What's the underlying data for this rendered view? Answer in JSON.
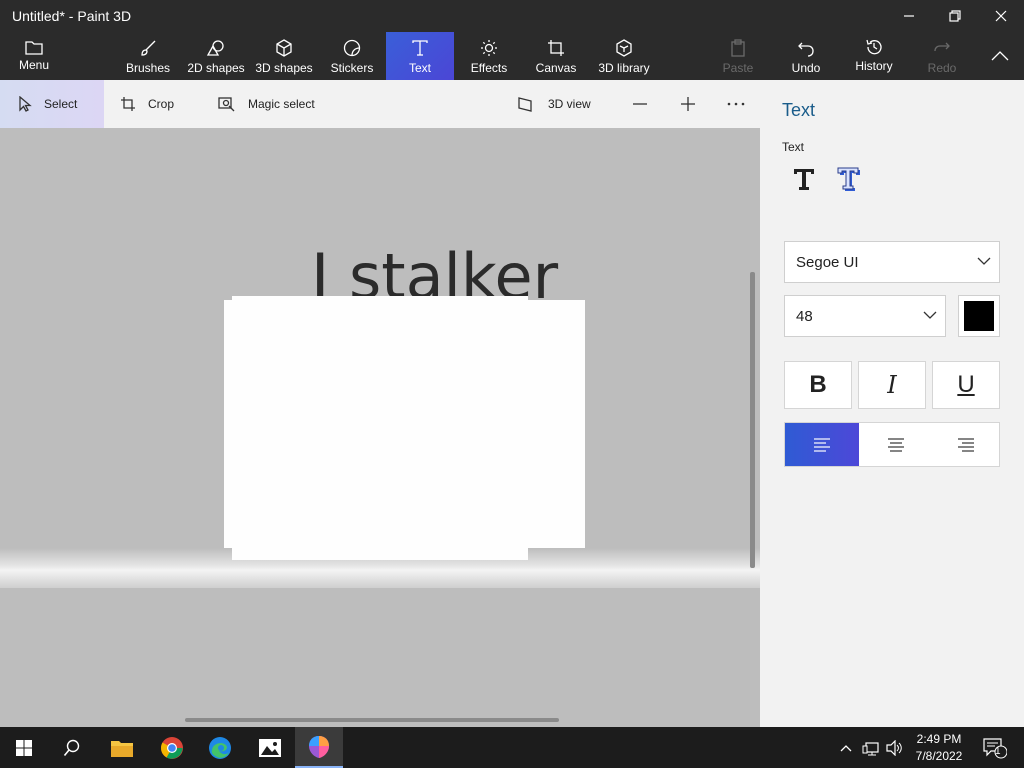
{
  "window": {
    "title": "Untitled* - Paint 3D"
  },
  "ribbon": {
    "items": [
      {
        "label": "Menu",
        "icon": "folder-icon"
      },
      {
        "label": "Brushes",
        "icon": "brush-icon"
      },
      {
        "label": "2D shapes",
        "icon": "2d-shapes-icon"
      },
      {
        "label": "3D shapes",
        "icon": "cube-icon"
      },
      {
        "label": "Stickers",
        "icon": "sticker-icon"
      },
      {
        "label": "Text",
        "icon": "text-icon",
        "active": true
      },
      {
        "label": "Effects",
        "icon": "sun-icon"
      },
      {
        "label": "Canvas",
        "icon": "canvas-icon"
      },
      {
        "label": "3D library",
        "icon": "3d-library-icon"
      },
      {
        "label": "Paste",
        "icon": "clipboard-icon",
        "disabled": true
      },
      {
        "label": "Undo",
        "icon": "undo-icon"
      },
      {
        "label": "History",
        "icon": "history-icon"
      },
      {
        "label": "Redo",
        "icon": "redo-icon",
        "disabled": true
      }
    ]
  },
  "toolbar": {
    "select": "Select",
    "crop": "Crop",
    "magic_select": "Magic select",
    "view_3d": "3D view"
  },
  "canvas": {
    "text": "I stalker"
  },
  "panel": {
    "title": "Text",
    "text_label": "Text",
    "font": "Segoe UI",
    "size": "48",
    "text_color": "#000000",
    "bold": "B",
    "italic": "I",
    "underline": "U",
    "alignment": "left"
  },
  "taskbar": {
    "time": "2:49 PM",
    "date": "7/8/2022",
    "notification_count": "1"
  },
  "colors": {
    "accent": "#3a5fd8",
    "panel_title": "#1a5c8a",
    "workspace": "#bdbdbd"
  }
}
